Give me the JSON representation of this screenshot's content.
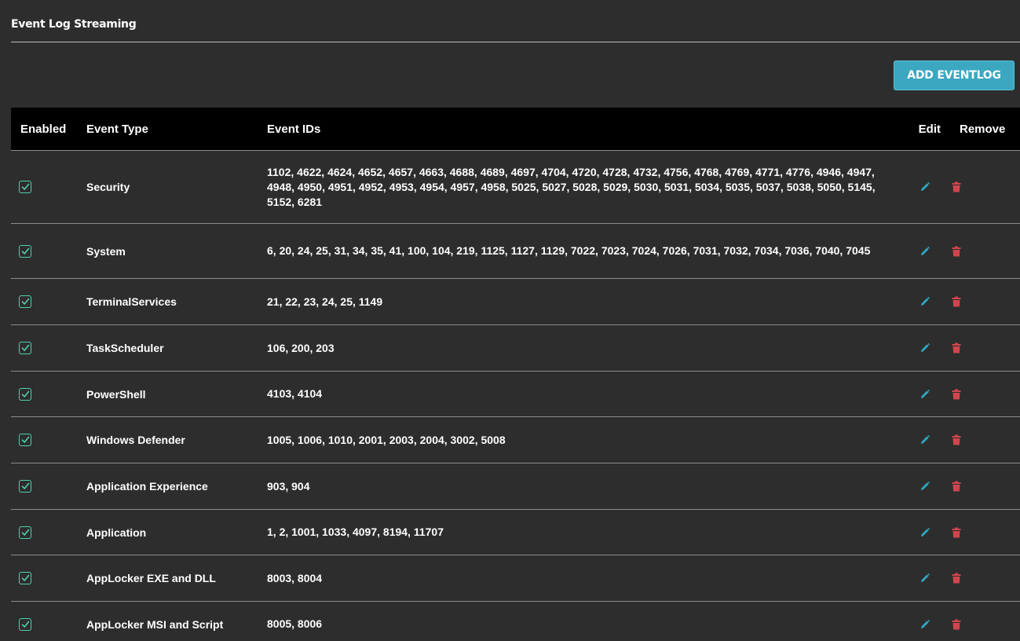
{
  "header": {
    "title": "Event Log Streaming",
    "add_button_label": "ADD EVENTLOG"
  },
  "colors": {
    "background": "#2d2d2d",
    "accent": "#3ba7c0",
    "checkbox": "#4fd1b0",
    "edit_icon": "#2ea8c4",
    "delete_icon": "#d0454d"
  },
  "table": {
    "columns": {
      "enabled": "Enabled",
      "event_type": "Event Type",
      "event_ids": "Event IDs",
      "edit": "Edit",
      "remove": "Remove"
    },
    "rows": [
      {
        "enabled": true,
        "event_type": "Security",
        "event_ids": "1102, 4622, 4624, 4652, 4657, 4663, 4688, 4689, 4697, 4704, 4720, 4728, 4732, 4756, 4768, 4769, 4771, 4776, 4946, 4947, 4948, 4950, 4951, 4952, 4953, 4954, 4957, 4958, 5025, 5027, 5028, 5029, 5030, 5031, 5034, 5035, 5037, 5038, 5050, 5145, 5152, 6281"
      },
      {
        "enabled": true,
        "event_type": "System",
        "event_ids": "6, 20, 24, 25, 31, 34, 35, 41, 100, 104, 219, 1125, 1127, 1129, 7022, 7023, 7024, 7026, 7031, 7032, 7034, 7036, 7040, 7045"
      },
      {
        "enabled": true,
        "event_type": "TerminalServices",
        "event_ids": "21, 22, 23, 24, 25, 1149"
      },
      {
        "enabled": true,
        "event_type": "TaskScheduler",
        "event_ids": "106, 200, 203"
      },
      {
        "enabled": true,
        "event_type": "PowerShell",
        "event_ids": "4103, 4104"
      },
      {
        "enabled": true,
        "event_type": "Windows Defender",
        "event_ids": "1005, 1006, 1010, 2001, 2003, 2004, 3002, 5008"
      },
      {
        "enabled": true,
        "event_type": "Application Experience",
        "event_ids": "903, 904"
      },
      {
        "enabled": true,
        "event_type": "Application",
        "event_ids": "1, 2, 1001, 1033, 4097, 8194, 11707"
      },
      {
        "enabled": true,
        "event_type": "AppLocker EXE and DLL",
        "event_ids": "8003, 8004"
      },
      {
        "enabled": true,
        "event_type": "AppLocker MSI and Script",
        "event_ids": "8005, 8006"
      }
    ],
    "row_icons": {
      "enabled": "checkbox-checked-icon",
      "edit": "pencil-icon",
      "remove": "trash-icon"
    }
  }
}
